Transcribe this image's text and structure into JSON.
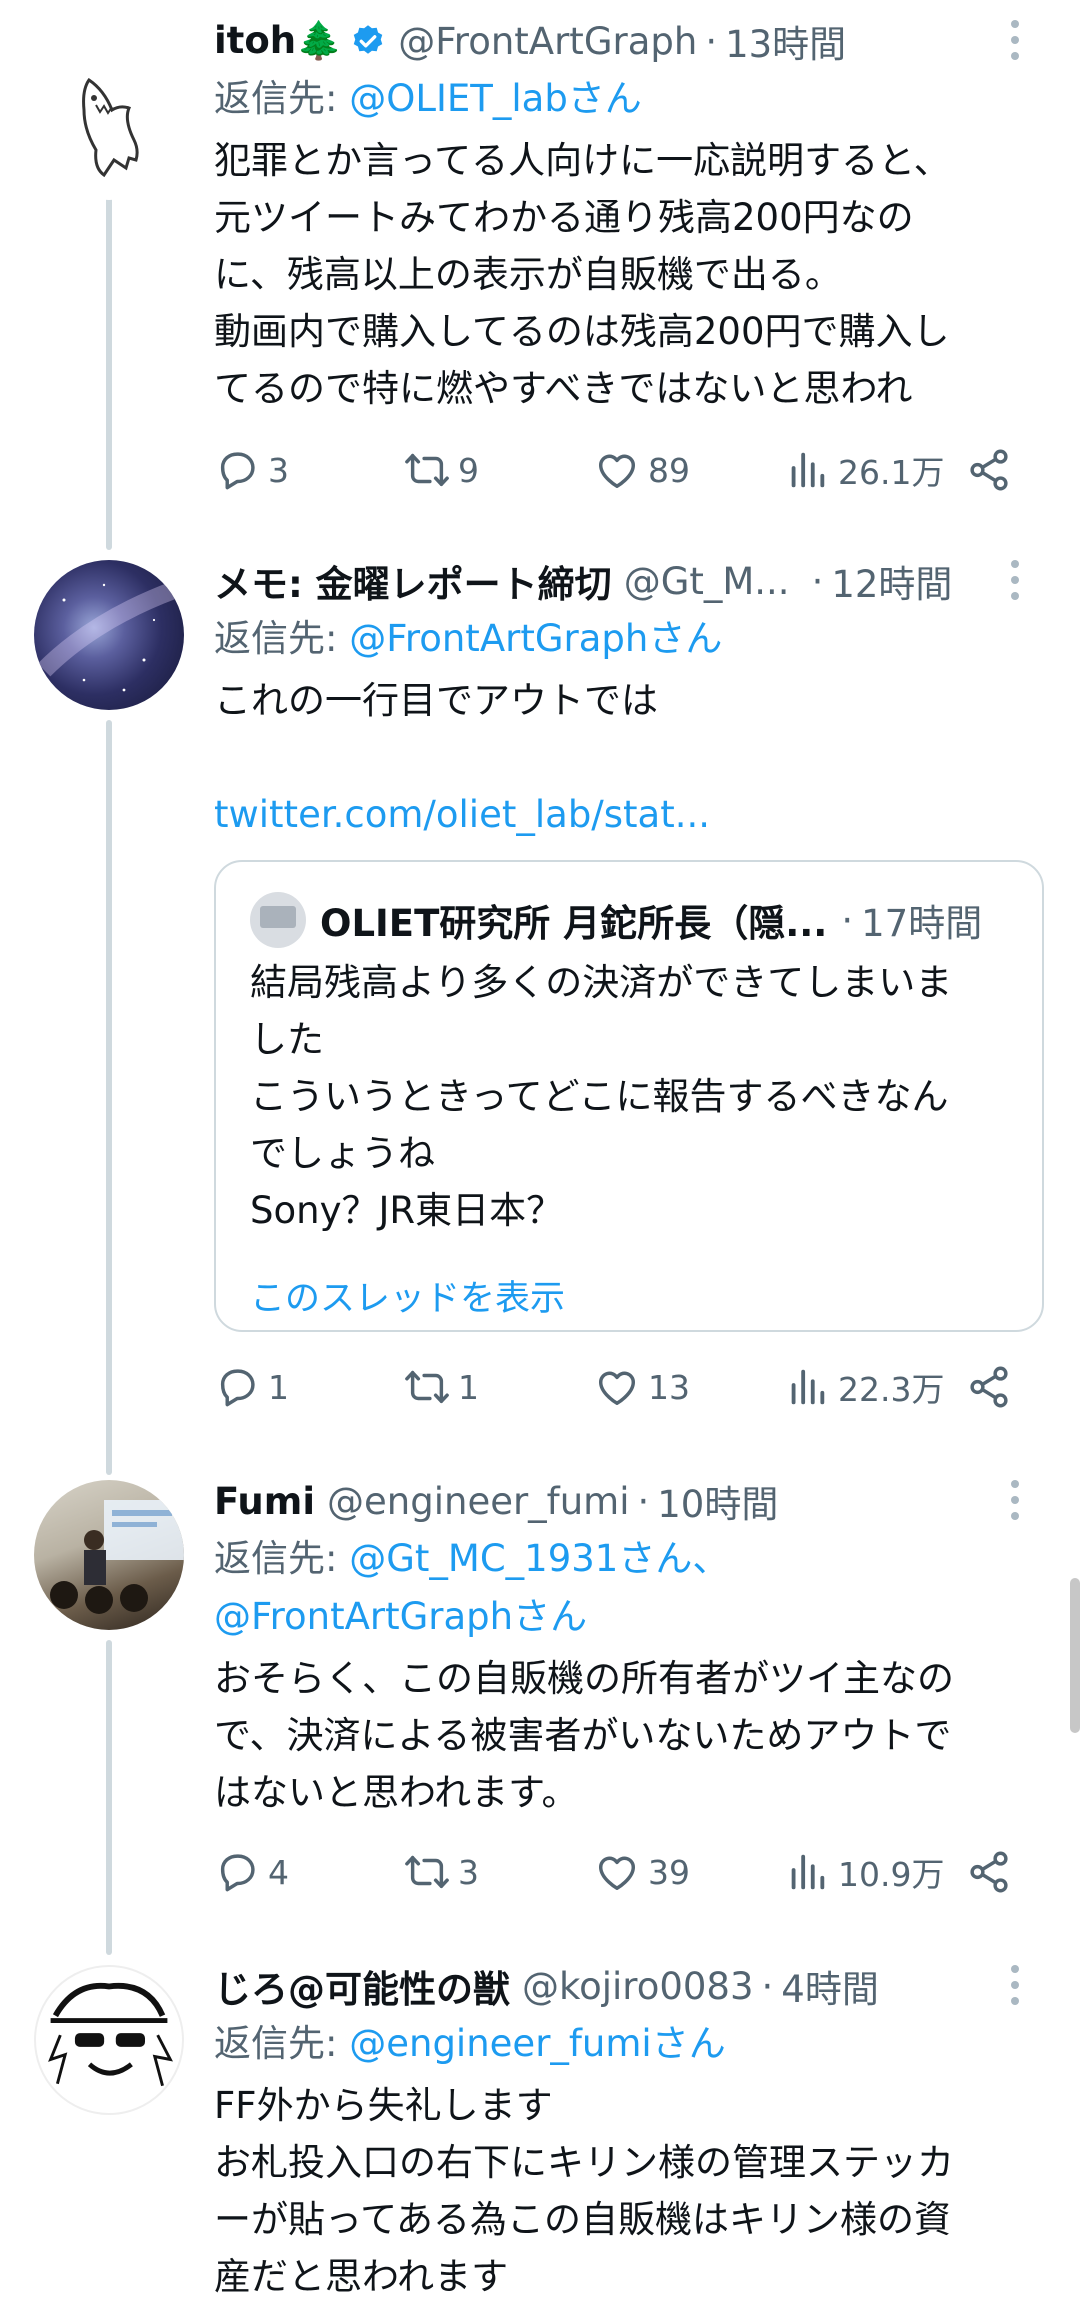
{
  "tweets": [
    {
      "name": "itoh🌲",
      "verified": true,
      "handle": "@FrontArtGraph",
      "time": "13時間",
      "reply_label": "返信先: ",
      "reply_to": "@OLIET_labさん",
      "text": "犯罪とか言ってる人向けに一応説明すると、\n元ツイートみてわかる通り残高200円なの\nに、残高以上の表示が自販機で出る。\n動画内で購入してるのは残高200円で購入し\nてるので特に燃やすべきではないと思われ",
      "replies": "3",
      "retweets": "9",
      "likes": "89",
      "views": "26.1万"
    },
    {
      "name": "メモ: 金曜レポート締切",
      "handle": "@Gt_M...",
      "time": "12時間",
      "reply_label": "返信先: ",
      "reply_to": "@FrontArtGraphさん",
      "text": "これの一行目でアウトでは",
      "url": "twitter.com/oliet_lab/stat...",
      "quote": {
        "name": "OLIET研究所 月鉈所長（隠...",
        "time": "17時間",
        "text": "結局残高より多くの決済ができてしまいま\nした\nこういうときってどこに報告するべきなん\nでしょうね\nSony？JR東日本？",
        "show_thread": "このスレッドを表示"
      },
      "replies": "1",
      "retweets": "1",
      "likes": "13",
      "views": "22.3万"
    },
    {
      "name": "Fumi",
      "handle": "@engineer_fumi",
      "time": "10時間",
      "reply_label": "返信先: ",
      "reply_to": "@Gt_MC_1931さん、\n@FrontArtGraphさん",
      "text": "おそらく、この自販機の所有者がツイ主なの\nで、決済による被害者がいないためアウトで\nはないと思われます。",
      "replies": "4",
      "retweets": "3",
      "likes": "39",
      "views": "10.9万"
    },
    {
      "name": "じろ@可能性の獣",
      "handle": "@kojiro0083",
      "time": "4時間",
      "reply_label": "返信先: ",
      "reply_to": "@engineer_fumiさん",
      "text": "FF外から失礼します\nお札投入口の右下にキリン様の管理ステッカ\nーが貼ってある為この自販機はキリン様の資\n産だと思われます"
    }
  ],
  "separator": "·",
  "colors": {
    "accent": "#1d9bf0",
    "secondary": "#536471",
    "line": "#cfd9de"
  }
}
